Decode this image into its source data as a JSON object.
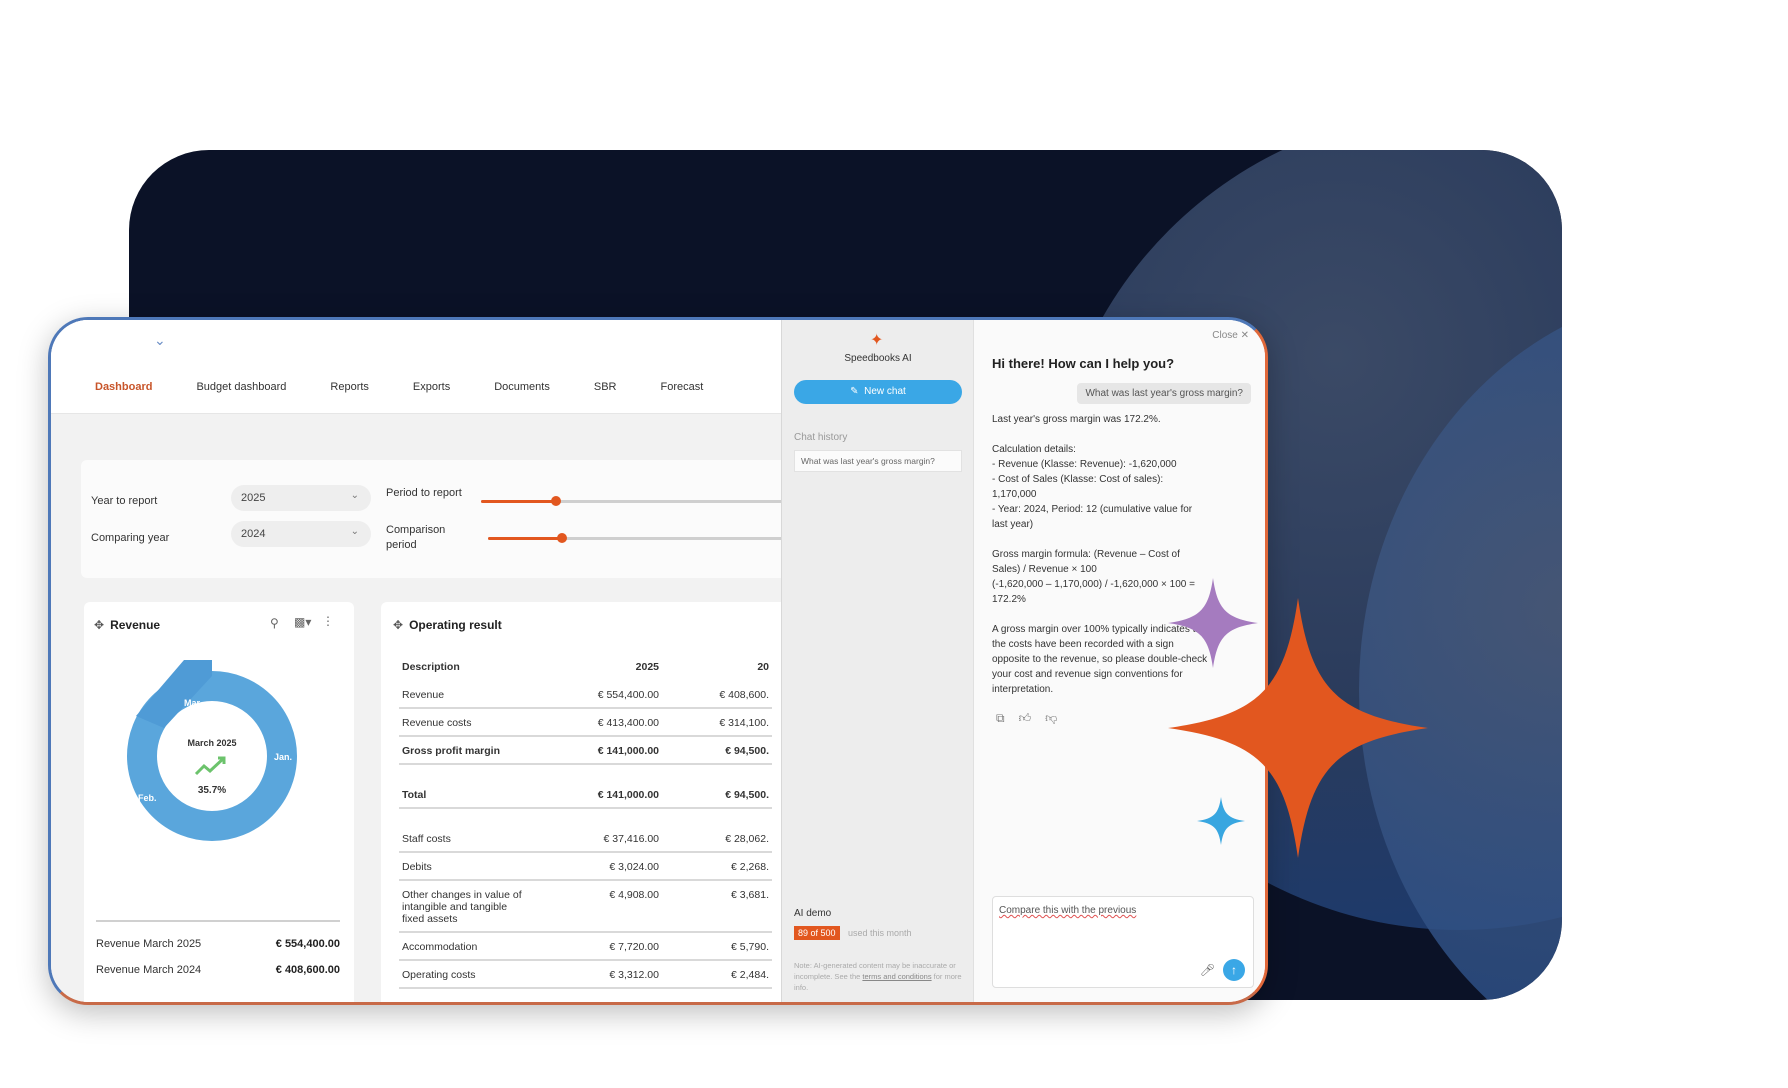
{
  "nav": {
    "items": [
      "Dashboard",
      "Budget dashboard",
      "Reports",
      "Exports",
      "Documents",
      "SBR",
      "Forecast"
    ],
    "active": "Dashboard"
  },
  "filters": {
    "year_label": "Year to report",
    "year_value": "2025",
    "comparing_label": "Comparing year",
    "comparing_value": "2024",
    "period_label": "Period to report",
    "comparison_period_label": "Comparison period"
  },
  "revenue_card": {
    "title": "Revenue",
    "center_title": "March 2025",
    "center_value": "35.7%",
    "segments": [
      "Mar.",
      "Jan.",
      "Feb."
    ],
    "rows": [
      {
        "label": "Revenue March 2025",
        "value": "€ 554,400.00"
      },
      {
        "label": "Revenue March 2024",
        "value": "€ 408,600.00"
      }
    ]
  },
  "operating_card": {
    "title": "Operating result",
    "columns": [
      "Description",
      "2025",
      "20"
    ],
    "rows": [
      {
        "d": "Revenue",
        "a": "€ 554,400.00",
        "b": "€ 408,600.",
        "bold": false
      },
      {
        "d": "Revenue costs",
        "a": "€ 413,400.00",
        "b": "€ 314,100.",
        "bold": false
      },
      {
        "d": "Gross profit margin",
        "a": "€ 141,000.00",
        "b": "€ 94,500.",
        "bold": true
      },
      {
        "d": "Total",
        "a": "€ 141,000.00",
        "b": "€ 94,500.",
        "bold": true
      },
      {
        "d": "Staff costs",
        "a": "€ 37,416.00",
        "b": "€ 28,062.",
        "bold": false
      },
      {
        "d": "Debits",
        "a": "€ 3,024.00",
        "b": "€ 2,268.",
        "bold": false
      },
      {
        "d": "Other changes in value of intangible and tangible fixed assets",
        "a": "€ 4,908.00",
        "b": "€ 3,681.",
        "bold": false
      },
      {
        "d": "Accommodation",
        "a": "€ 7,720.00",
        "b": "€ 5,790.",
        "bold": false
      },
      {
        "d": "Operating costs",
        "a": "€ 3,312.00",
        "b": "€ 2,484.",
        "bold": false
      }
    ]
  },
  "ai_sidebar": {
    "title": "Speedbooks AI",
    "new_chat": "New chat",
    "history_label": "Chat history",
    "history_item": "What was last year's gross margin?",
    "demo_label": "AI demo",
    "usage_badge": "89 of 500",
    "usage_text": "used this month",
    "note_a": "Note: AI-generated content may be inaccurate or incomplete. See the ",
    "note_link": "terms and conditions",
    "note_b": " for more info."
  },
  "ai_chat": {
    "close": "Close",
    "greeting": "Hi there! How can I help you?",
    "user_message": "What was last year's gross margin?",
    "answer_p1": "Last year's gross margin was 172.2%.",
    "answer_p2": "Calculation details:\n- Revenue (Klasse: Revenue): -1,620,000\n- Cost of Sales (Klasse: Cost of sales): 1,170,000\n- Year: 2024, Period: 12 (cumulative value for last year)",
    "answer_p3": "Gross margin formula: (Revenue – Cost of Sales) / Revenue × 100\n(-1,620,000 – 1,170,000) / -1,620,000 × 100 = 172.2%",
    "answer_p4": "A gross margin over 100% typically indicates that the costs have been recorded with a sign opposite to the revenue, so please double-check your cost and revenue sign conventions for interpretation.",
    "input_value": "Compare this with the previous"
  },
  "colors": {
    "accent": "#e2571f",
    "blue": "#3aa7e6",
    "donut": "#5aa6dc",
    "background_dark": "#0b1227",
    "sparkle_purple": "#a57bbf",
    "sparkle_blue": "#38a6e0"
  },
  "icons": [
    "chevron-down-icon",
    "drag-icon",
    "zoom-icon",
    "bar-chart-icon",
    "more-icon",
    "trend-up-icon",
    "edit-icon",
    "copy-icon",
    "thumbs-up-icon",
    "thumbs-down-icon",
    "mic-icon",
    "send-icon",
    "sparkle-icon"
  ]
}
